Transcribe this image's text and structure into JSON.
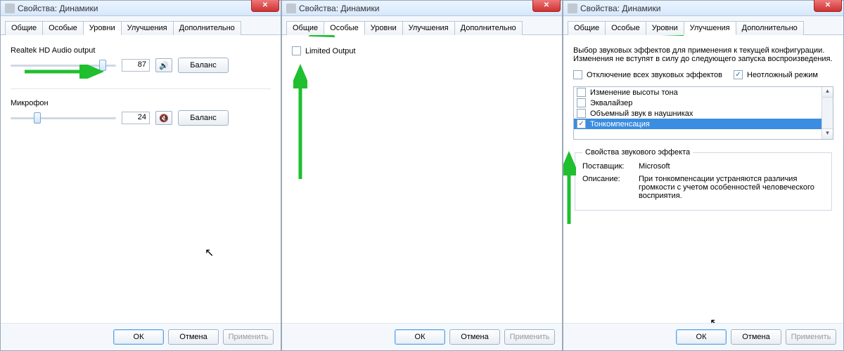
{
  "windows": {
    "w1": {
      "title": "Свойства: Динамики",
      "tabs": [
        "Общие",
        "Особые",
        "Уровни",
        "Улучшения",
        "Дополнительно"
      ],
      "active_tab": "Уровни",
      "device1": {
        "label": "Realtek HD Audio output",
        "value": "87",
        "balance": "Баланс"
      },
      "device2": {
        "label": "Микрофон",
        "value": "24",
        "balance": "Баланс"
      },
      "buttons": {
        "ok": "ОК",
        "cancel": "Отмена",
        "apply": "Применить"
      }
    },
    "w2": {
      "title": "Свойства: Динамики",
      "tabs": [
        "Общие",
        "Особые",
        "Уровни",
        "Улучшения",
        "Дополнительно"
      ],
      "active_tab": "Особые",
      "checkbox": "Limited Output",
      "buttons": {
        "ok": "ОК",
        "cancel": "Отмена",
        "apply": "Применить"
      }
    },
    "w3": {
      "title": "Свойства: Динамики",
      "tabs": [
        "Общие",
        "Особые",
        "Уровни",
        "Улучшения",
        "Дополнительно"
      ],
      "active_tab": "Улучшения",
      "intro": "Выбор звуковых эффектов для применения к текущей конфигурации. Изменения не вступят в силу до следующего запуска воспроизведения.",
      "disable_all": "Отключение всех звуковых эффектов",
      "urgent_mode": "Неотложный режим",
      "effects": [
        "Изменение высоты тона",
        "Эквалайзер",
        "Объемный звук в наушниках",
        "Тонкомпенсация"
      ],
      "selected_effect": "Тонкомпенсация",
      "props_legend": "Свойства звукового эффекта",
      "provider_k": "Поставщик:",
      "provider_v": "Microsoft",
      "desc_k": "Описание:",
      "desc_v": "При тонкомпенсации устраняются различия громкости с учетом особенностей человеческого восприятия.",
      "buttons": {
        "ok": "ОК",
        "cancel": "Отмена",
        "apply": "Применить"
      }
    }
  }
}
